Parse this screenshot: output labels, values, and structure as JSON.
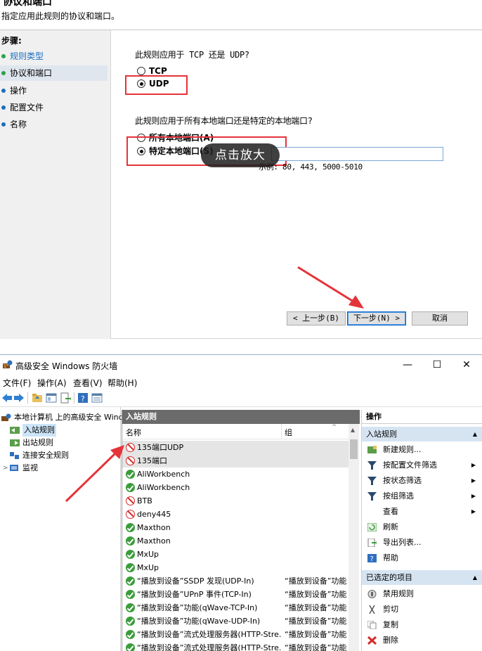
{
  "wizard": {
    "title": "协议和端口",
    "subtitle": "指定应用此规则的协议和端口。",
    "steps_heading": "步骤:",
    "steps": [
      {
        "label": "规则类型",
        "state": "done"
      },
      {
        "label": "协议和端口",
        "state": "current"
      },
      {
        "label": "操作",
        "state": "pending"
      },
      {
        "label": "配置文件",
        "state": "pending"
      },
      {
        "label": "名称",
        "state": "pending"
      }
    ],
    "protocol_question": "此规则应用于 TCP 还是 UDP?",
    "protocol_options": [
      {
        "label": "TCP",
        "checked": false
      },
      {
        "label": "UDP",
        "checked": true
      }
    ],
    "port_question": "此规则应用于所有本地端口还是特定的本地端口?",
    "port_options": [
      {
        "label": "所有本地端口(A)",
        "checked": false
      },
      {
        "label": "特定本地端口(S)",
        "checked": true
      }
    ],
    "port_value": "",
    "port_example": "示例: 80, 443, 5000-5010",
    "zoom_overlay": "点击放大",
    "buttons": {
      "back": "< 上一步(B)",
      "next": "下一步(N) >",
      "cancel": "取消"
    }
  },
  "firewall": {
    "title": "高级安全 Windows 防火墙",
    "window_controls": {
      "minimize": "—",
      "maximize": "☐",
      "close": "✕"
    },
    "menu": [
      "文件(F)",
      "操作(A)",
      "查看(V)",
      "帮助(H)"
    ],
    "tree": [
      {
        "label": "本地计算机 上的高级安全 Windo",
        "indent": 0,
        "selected": false
      },
      {
        "label": "入站规则",
        "indent": 1,
        "selected": true
      },
      {
        "label": "出站规则",
        "indent": 1,
        "selected": false
      },
      {
        "label": "连接安全规则",
        "indent": 1,
        "selected": false
      },
      {
        "label": "监视",
        "indent": 1,
        "selected": false
      }
    ],
    "list": {
      "caption": "入站规则",
      "columns": [
        "名称",
        "组"
      ],
      "rows": [
        {
          "icon": "block",
          "name": "135端口UDP",
          "group": ""
        },
        {
          "icon": "block",
          "name": "135端口",
          "group": ""
        },
        {
          "icon": "ok",
          "name": "AliWorkbench",
          "group": ""
        },
        {
          "icon": "ok",
          "name": "AliWorkbench",
          "group": ""
        },
        {
          "icon": "block",
          "name": "BTB",
          "group": ""
        },
        {
          "icon": "block",
          "name": "deny445",
          "group": ""
        },
        {
          "icon": "ok",
          "name": "Maxthon",
          "group": ""
        },
        {
          "icon": "ok",
          "name": "Maxthon",
          "group": ""
        },
        {
          "icon": "ok",
          "name": "MxUp",
          "group": ""
        },
        {
          "icon": "ok",
          "name": "MxUp",
          "group": ""
        },
        {
          "icon": "ok",
          "name": "“播放到设备”SSDP 发现(UDP-In)",
          "group": "“播放到设备”功能"
        },
        {
          "icon": "ok",
          "name": "“播放到设备”UPnP 事件(TCP-In)",
          "group": "“播放到设备”功能"
        },
        {
          "icon": "ok",
          "name": "“播放到设备”功能(qWave-TCP-In)",
          "group": "“播放到设备”功能"
        },
        {
          "icon": "ok",
          "name": "“播放到设备”功能(qWave-UDP-In)",
          "group": "“播放到设备”功能"
        },
        {
          "icon": "ok",
          "name": "“播放到设备”流式处理服务器(HTTP-Stre...",
          "group": "“播放到设备”功能"
        },
        {
          "icon": "ok",
          "name": "“播放到设备”流式处理服务器(HTTP-Stre...",
          "group": "“播放到设备”功能"
        }
      ]
    },
    "actions": {
      "caption": "操作",
      "section1": "入站规则",
      "items1": [
        {
          "label": "新建规则...",
          "icon": "new-rule-icon",
          "submenu": false
        },
        {
          "label": "按配置文件筛选",
          "icon": "filter-icon",
          "submenu": true
        },
        {
          "label": "按状态筛选",
          "icon": "filter-icon",
          "submenu": true
        },
        {
          "label": "按组筛选",
          "icon": "filter-icon",
          "submenu": true
        },
        {
          "label": "查看",
          "icon": "",
          "submenu": true
        },
        {
          "label": "刷新",
          "icon": "refresh-icon",
          "submenu": false
        },
        {
          "label": "导出列表...",
          "icon": "export-icon",
          "submenu": false
        },
        {
          "label": "帮助",
          "icon": "help-icon",
          "submenu": false
        }
      ],
      "section2": "已选定的项目",
      "items2": [
        {
          "label": "禁用规则",
          "icon": "disable-icon"
        },
        {
          "label": "剪切",
          "icon": "cut-icon"
        },
        {
          "label": "复制",
          "icon": "copy-icon"
        },
        {
          "label": "删除",
          "icon": "delete-icon"
        }
      ]
    }
  },
  "colors": {
    "annotation_red": "#e5333a",
    "selection_blue": "#cce4f7",
    "section_blue": "#d6e4f2",
    "list_header_gray": "#6b6b6b",
    "allow_green": "#3a9d3a",
    "block_red": "#d62b2b"
  }
}
